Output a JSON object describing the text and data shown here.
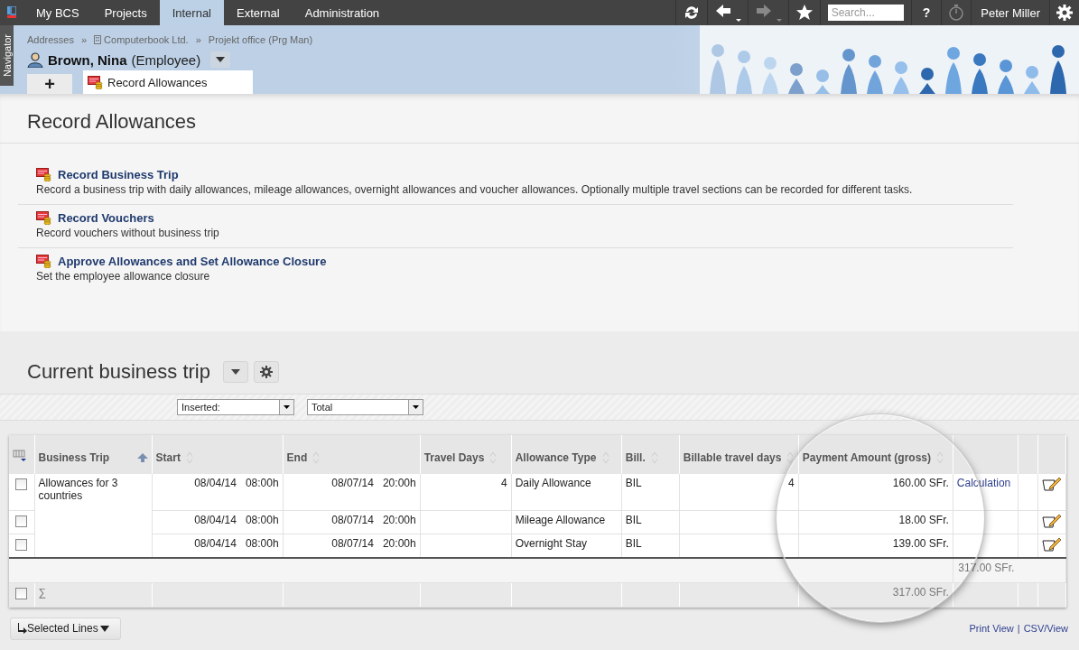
{
  "top_nav": {
    "tabs": [
      {
        "label": "My BCS",
        "selected": false
      },
      {
        "label": "Projects",
        "selected": false
      },
      {
        "label": "Internal",
        "selected": true
      },
      {
        "label": "External",
        "selected": false
      },
      {
        "label": "Administration",
        "selected": false
      }
    ],
    "search": {
      "placeholder": "Search..."
    },
    "help": "?",
    "forward_disabled": true,
    "timer_disabled": true,
    "user": "Peter Miller"
  },
  "navigator": {
    "label": "Navigator"
  },
  "breadcrumb": [
    {
      "label": "Addresses",
      "kind": "text"
    },
    {
      "label": "»",
      "kind": "separator"
    },
    {
      "label": "Computerbook Ltd.",
      "kind": "building"
    },
    {
      "label": "»",
      "kind": "separator"
    },
    {
      "label": "Projekt office (Prg Man)",
      "kind": "text"
    }
  ],
  "person": {
    "name": "Brown, Nina",
    "role": "(Employee)"
  },
  "tabs": [
    {
      "label": "+",
      "kind": "add",
      "selected": false
    },
    {
      "label": "Record Allowances",
      "kind": "page",
      "selected": true
    }
  ],
  "page_title": "Record Allowances",
  "actions": [
    {
      "title": "Record Business Trip",
      "description": "Record a business trip with daily allowances, mileage allowances, overnight allowances and voucher allowances. Optionally multiple travel sections can be recorded for different tasks."
    },
    {
      "title": "Record Vouchers",
      "description": "Record vouchers without business trip"
    },
    {
      "title": "Approve Allowances and Set Allowance Closure",
      "description": "Set the employee allowance closure"
    }
  ],
  "section_title": "Current business trip",
  "filters": [
    {
      "value": "Inserted:"
    },
    {
      "value": "Total"
    }
  ],
  "table": {
    "columns": [
      {
        "label": "Business Trip",
        "sorted_ascending": true
      },
      {
        "label": "Start",
        "sorted_ascending": false
      },
      {
        "label": "End",
        "sorted_ascending": false
      },
      {
        "label": "Travel Days",
        "sorted_ascending": false
      },
      {
        "label": "Allowance Type",
        "sorted_ascending": false
      },
      {
        "label": "Bill.",
        "sorted_ascending": false
      },
      {
        "label": "Billable travel days",
        "sorted_ascending": false
      },
      {
        "label": "Payment Amount (gross)",
        "sorted_ascending": false
      }
    ],
    "groups": [
      {
        "business_trip": "Allowances for 3 countries",
        "entries": [
          {
            "checked": false,
            "start": "08/04/14   08:00h",
            "end": "08/07/14   20:00h",
            "travel_days": "4",
            "allowance_type": "Daily Allowance",
            "bill": "BIL",
            "billable_travel_days": "4",
            "payment_amount": "160.00 SFr.",
            "link": "Calculation"
          },
          {
            "checked": false,
            "start": "08/04/14   08:00h",
            "end": "08/07/14   20:00h",
            "allowance_type": "Mileage Allowance",
            "bill": "BIL",
            "payment_amount": "18.00 SFr."
          },
          {
            "checked": false,
            "start": "08/04/14   08:00h",
            "end": "08/07/14   20:00h",
            "allowance_type": "Overnight Stay",
            "bill": "BIL",
            "payment_amount": "139.00 SFr."
          }
        ]
      }
    ],
    "subtotal": "317.00 SFr.",
    "sum_row": {
      "checked": false,
      "symbol": "∑",
      "payment_amount": "317.00 SFr."
    }
  },
  "bulk_button": "Selected Lines",
  "footer_links": [
    {
      "label": "Print View"
    },
    {
      "label": "CSV/View"
    }
  ],
  "link_separator": "|"
}
